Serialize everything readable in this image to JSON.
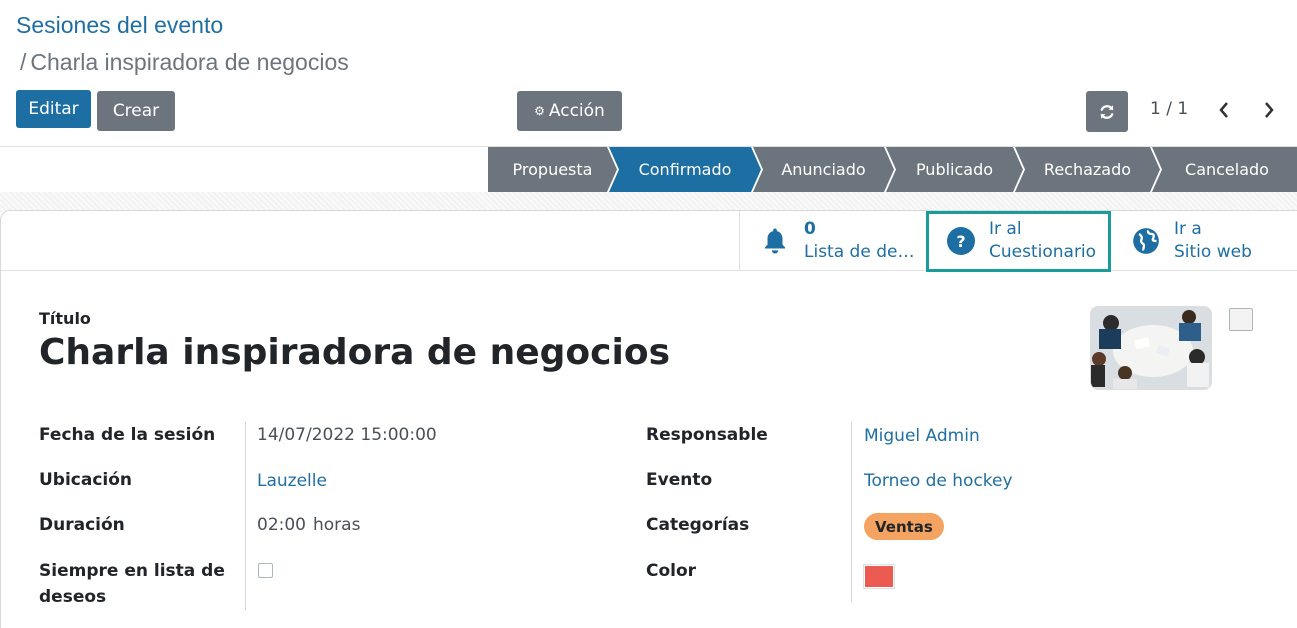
{
  "breadcrumb": {
    "parent": "Sesiones del evento",
    "separator": "/",
    "current": "Charla inspiradora de negocios"
  },
  "toolbar": {
    "edit_label": "Editar",
    "create_label": "Crear",
    "action_label": "Acción",
    "action_icon": "gear-icon",
    "refresh_icon": "refresh-icon"
  },
  "pager": {
    "value": "1 / 1",
    "prev_icon": "chevron-left-icon",
    "next_icon": "chevron-right-icon"
  },
  "statusbar": {
    "stages": [
      "Propuesta",
      "Confirmado",
      "Anunciado",
      "Publicado",
      "Rechazado",
      "Cancelado"
    ],
    "active": "Confirmado"
  },
  "smart_buttons": {
    "wishlist": {
      "count": "0",
      "label": "Lista de de…",
      "icon": "bell-icon"
    },
    "quiz": {
      "line1": "Ir al",
      "line2": "Cuestionario",
      "icon": "question-circle-icon"
    },
    "website": {
      "line1": "Ir a",
      "line2": "Sitio web",
      "icon": "globe-icon"
    }
  },
  "form": {
    "title_label": "Título",
    "title": "Charla inspiradora de negocios",
    "left_fields": [
      {
        "label": "Fecha de la sesión",
        "value": "14/07/2022 15:00:00"
      },
      {
        "label": "Ubicación",
        "value": "Lauzelle"
      },
      {
        "label": "Duración",
        "value": "02:00",
        "unit": "horas"
      },
      {
        "label": "Siempre en lista de deseos",
        "value": ""
      }
    ],
    "right_fields": [
      {
        "label": "Responsable",
        "value": "Miguel Admin"
      },
      {
        "label": "Evento",
        "value": "Torneo de hockey"
      },
      {
        "label": "Categorías",
        "value": "Ventas"
      },
      {
        "label": "Color",
        "value": ""
      }
    ]
  },
  "colors": {
    "primary": "#1d6fa3",
    "secondary": "#6c757d",
    "highlight_border": "#1a9c9a",
    "tag_bg": "#f4a460",
    "color_swatch": "#ec5b52"
  }
}
